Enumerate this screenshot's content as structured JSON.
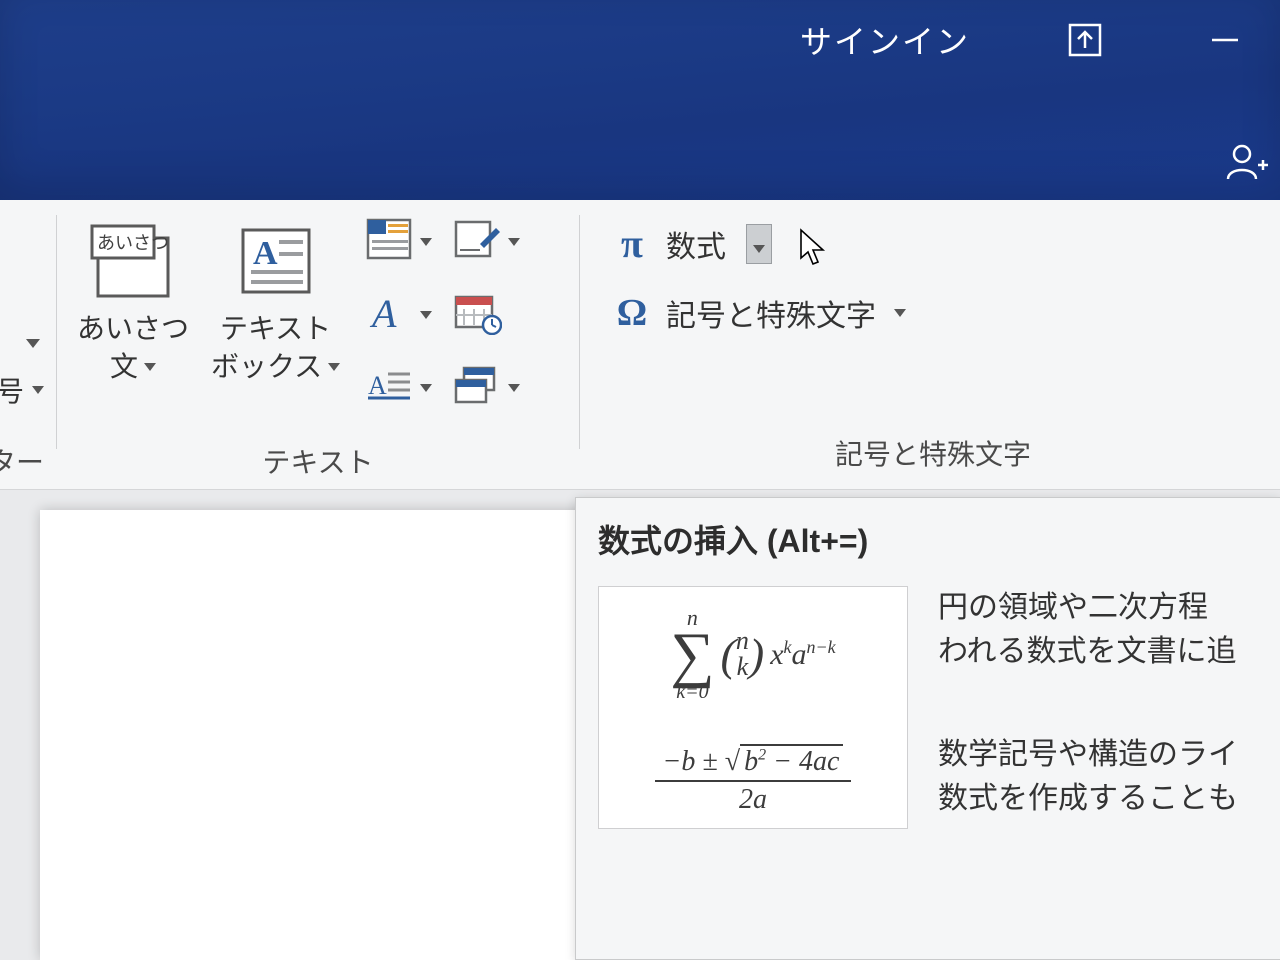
{
  "titlebar": {
    "signin": "サインイン"
  },
  "ribbon": {
    "left_partial": {
      "label_line1": "番号",
      "label_group": "ッター"
    },
    "greeting": {
      "label_line1": "あいさつ",
      "label_line2": "文",
      "icon_text": "あいさつ"
    },
    "textbox": {
      "label_line1": "テキスト",
      "label_line2": "ボックス"
    },
    "text_group_label": "テキスト",
    "symbols": {
      "equation_label": "数式",
      "symbol_label": "記号と特殊文字",
      "group_label": "記号と特殊文字"
    }
  },
  "tooltip": {
    "title": "数式の挿入 (Alt+=)",
    "desc_line1": "円の領域や二次方程",
    "desc_line2": "われる数式を文書に追",
    "desc_line3": "数学記号や構造のライ",
    "desc_line4": "数式を作成することも"
  }
}
